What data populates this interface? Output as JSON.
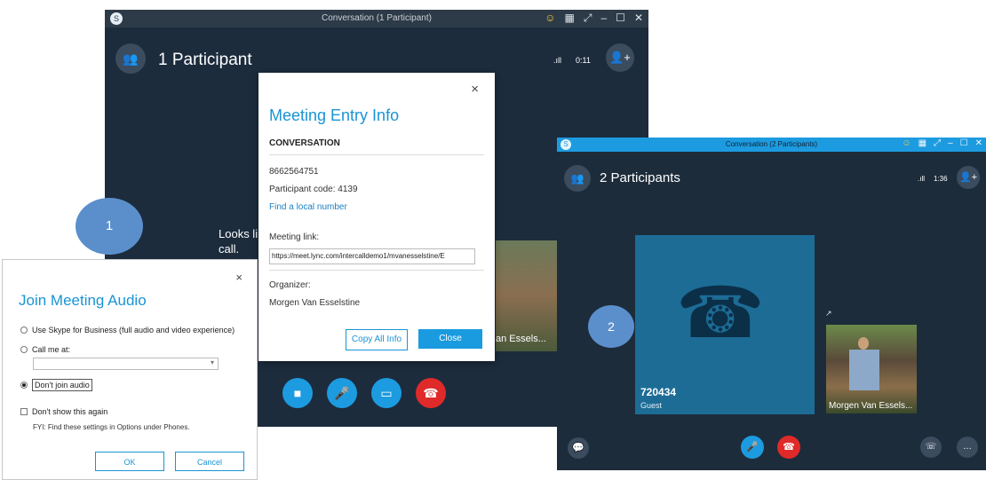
{
  "window1": {
    "title": "Conversation (1 Participant)",
    "participants_label": "1 Participant",
    "timer": "0:11",
    "body_text": "Looks li call."
  },
  "meeting_entry": {
    "title": "Meeting Entry Info",
    "section": "CONVERSATION",
    "phone": "8662564751",
    "participant_code": "Participant code: 4139",
    "local_number_link": "Find a local number",
    "meeting_link_label": "Meeting link:",
    "meeting_link_value": "https://meet.lync.com/intercalldemo1/mvanesselstine/E",
    "organizer_label": "Organizer:",
    "organizer_name": "Morgen Van Esselstine",
    "copy_button": "Copy All Info",
    "close_button": "Close",
    "close_x": "×"
  },
  "join_audio": {
    "title": "Join Meeting Audio",
    "close_x": "×",
    "option_skype": "Use Skype for Business (full audio and video experience)",
    "option_call": "Call me at:",
    "option_dont_join": "Don't join audio",
    "dont_show": "Don't show this again",
    "fyi": "FYI: Find these settings in Options under Phones.",
    "ok": "OK",
    "cancel": "Cancel"
  },
  "step1": "1",
  "step2": "2",
  "window2": {
    "title": "Conversation (2 Participants)",
    "participants_label": "2 Participants",
    "timer": "1:36",
    "guest_number": "720434",
    "guest_label": "Guest",
    "photo_name": "Morgen Van Essels...",
    "expand": "↗"
  },
  "window1_video_name": "an Essels...",
  "colors": {
    "accent": "#1a94d4",
    "call_blue": "#1d9be0",
    "hangup_red": "#e02a2a",
    "dark_bg": "#1c2c3d"
  }
}
